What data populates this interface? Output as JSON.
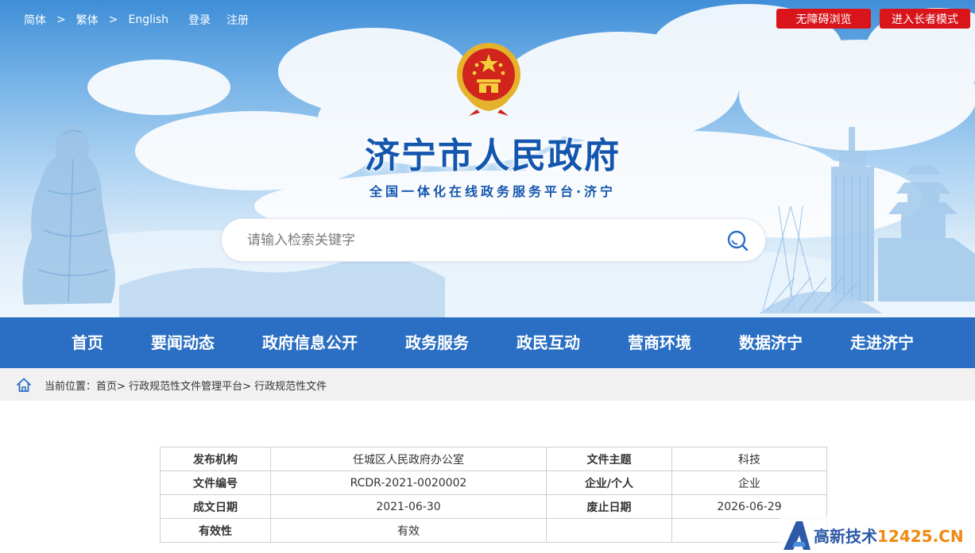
{
  "top_bar": {
    "lang_simplified": "简体",
    "lang_traditional": "繁体",
    "lang_english": "English",
    "separator": ">",
    "login": "登录",
    "register": "注册",
    "accessible_button": "无障碍浏览",
    "elder_button": "进入长者模式"
  },
  "header": {
    "title": "济宁市人民政府",
    "subtitle": "全国一体化在线政务服务平台·济宁"
  },
  "search": {
    "placeholder": "请输入检索关键字",
    "value": ""
  },
  "nav": {
    "items": [
      "首页",
      "要闻动态",
      "政府信息公开",
      "政务服务",
      "政民互动",
      "营商环境",
      "数据济宁",
      "走进济宁"
    ]
  },
  "breadcrumb": {
    "prefix": "当前位置：",
    "items": [
      "首页",
      "行政规范性文件管理平台",
      "行政规范性文件"
    ],
    "separator": ">"
  },
  "info_table": {
    "rows": [
      [
        {
          "key": "发布机构",
          "value": "任城区人民政府办公室"
        },
        {
          "key": "文件主题",
          "value": "科技"
        }
      ],
      [
        {
          "key": "文件编号",
          "value": "RCDR-2021-0020002"
        },
        {
          "key": "企业/个人",
          "value": "企业"
        }
      ],
      [
        {
          "key": "成文日期",
          "value": "2021-06-30"
        },
        {
          "key": "废止日期",
          "value": "2026-06-29"
        }
      ],
      [
        {
          "key": "有效性",
          "value": "有效"
        },
        {
          "key": "",
          "value": ""
        }
      ]
    ]
  },
  "watermark": {
    "name": "高新技术",
    "domain": "12425.CN"
  },
  "colors": {
    "nav_blue": "#2a6fc3",
    "title_blue": "#1356ae",
    "button_red": "#d9141b",
    "breadcrumb_bg": "#f1f1f1"
  },
  "icons": {
    "search": "search-icon",
    "home": "home-icon",
    "emblem": "national-emblem-icon"
  }
}
